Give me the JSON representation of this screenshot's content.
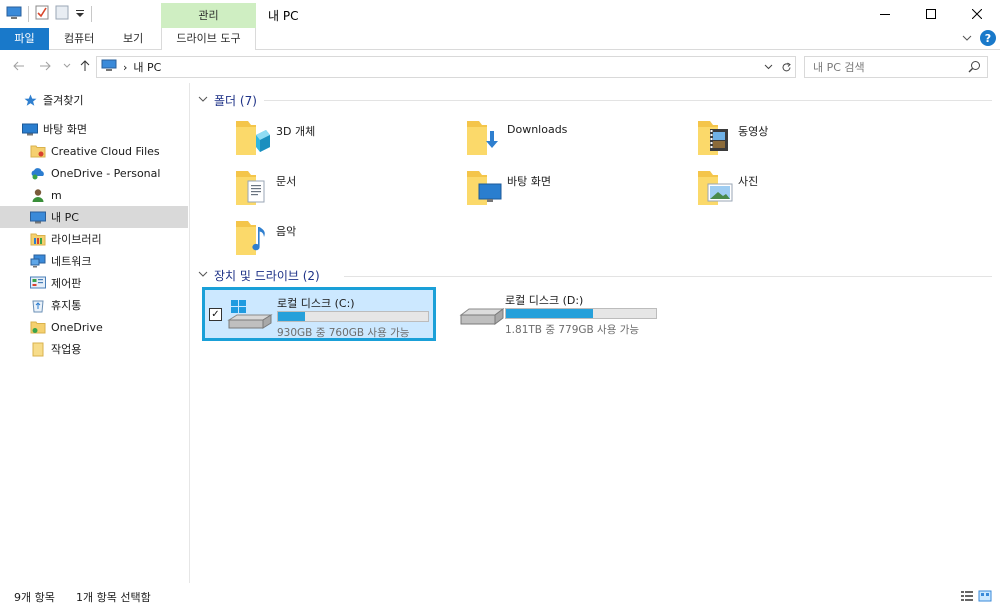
{
  "window": {
    "title": "내 PC",
    "context_tab": "관리"
  },
  "ribbon": {
    "tabs": [
      "파일",
      "컴퓨터",
      "보기",
      "드라이브 도구"
    ]
  },
  "address": {
    "path": "내 PC",
    "search_placeholder": "내 PC 검색"
  },
  "navpane": {
    "items": [
      {
        "label": "즐겨찾기",
        "icon": "star-icon"
      },
      {
        "label": "바탕 화면",
        "icon": "desktop-icon"
      },
      {
        "label": "Creative Cloud Files",
        "icon": "cloud-folder-icon"
      },
      {
        "label": "OneDrive - Personal",
        "icon": "onedrive-icon"
      },
      {
        "label": "m",
        "icon": "user-icon"
      },
      {
        "label": "내 PC",
        "icon": "computer-icon"
      },
      {
        "label": "라이브러리",
        "icon": "library-icon"
      },
      {
        "label": "네트워크",
        "icon": "network-icon"
      },
      {
        "label": "제어판",
        "icon": "control-panel-icon"
      },
      {
        "label": "휴지통",
        "icon": "recycle-bin-icon"
      },
      {
        "label": "OneDrive",
        "icon": "onedrive-folder-icon"
      },
      {
        "label": "작업용",
        "icon": "folder-icon"
      }
    ],
    "selected_index": 5
  },
  "folders": {
    "header": "폴더 (7)",
    "items": [
      {
        "label": "3D 개체",
        "icon": "3d-objects-icon"
      },
      {
        "label": "Downloads",
        "icon": "downloads-icon"
      },
      {
        "label": "동영상",
        "icon": "videos-icon"
      },
      {
        "label": "문서",
        "icon": "documents-icon"
      },
      {
        "label": "바탕 화면",
        "icon": "desktop-folder-icon"
      },
      {
        "label": "사진",
        "icon": "pictures-icon"
      },
      {
        "label": "음악",
        "icon": "music-icon"
      }
    ]
  },
  "drives": {
    "header": "장치 및 드라이브 (2)",
    "items": [
      {
        "label": "로컬 디스크 (C:)",
        "free_text": "930GB 중 760GB 사용 가능",
        "used_fraction": 0.183,
        "selected": true,
        "icon": "windows-drive-icon"
      },
      {
        "label": "로컬 디스크 (D:)",
        "free_text": "1.81TB 중 779GB 사용 가능",
        "used_fraction": 0.58,
        "selected": false,
        "icon": "hard-drive-icon"
      }
    ]
  },
  "status": {
    "count": "9개 항목",
    "selection": "1개 항목 선택함"
  },
  "colors": {
    "accent": "#1979ca",
    "context_tab": "#cfeec2",
    "drive_bar": "#26a0da",
    "selection_border": "#1aa0d8",
    "selection_fill": "#cce8ff"
  }
}
